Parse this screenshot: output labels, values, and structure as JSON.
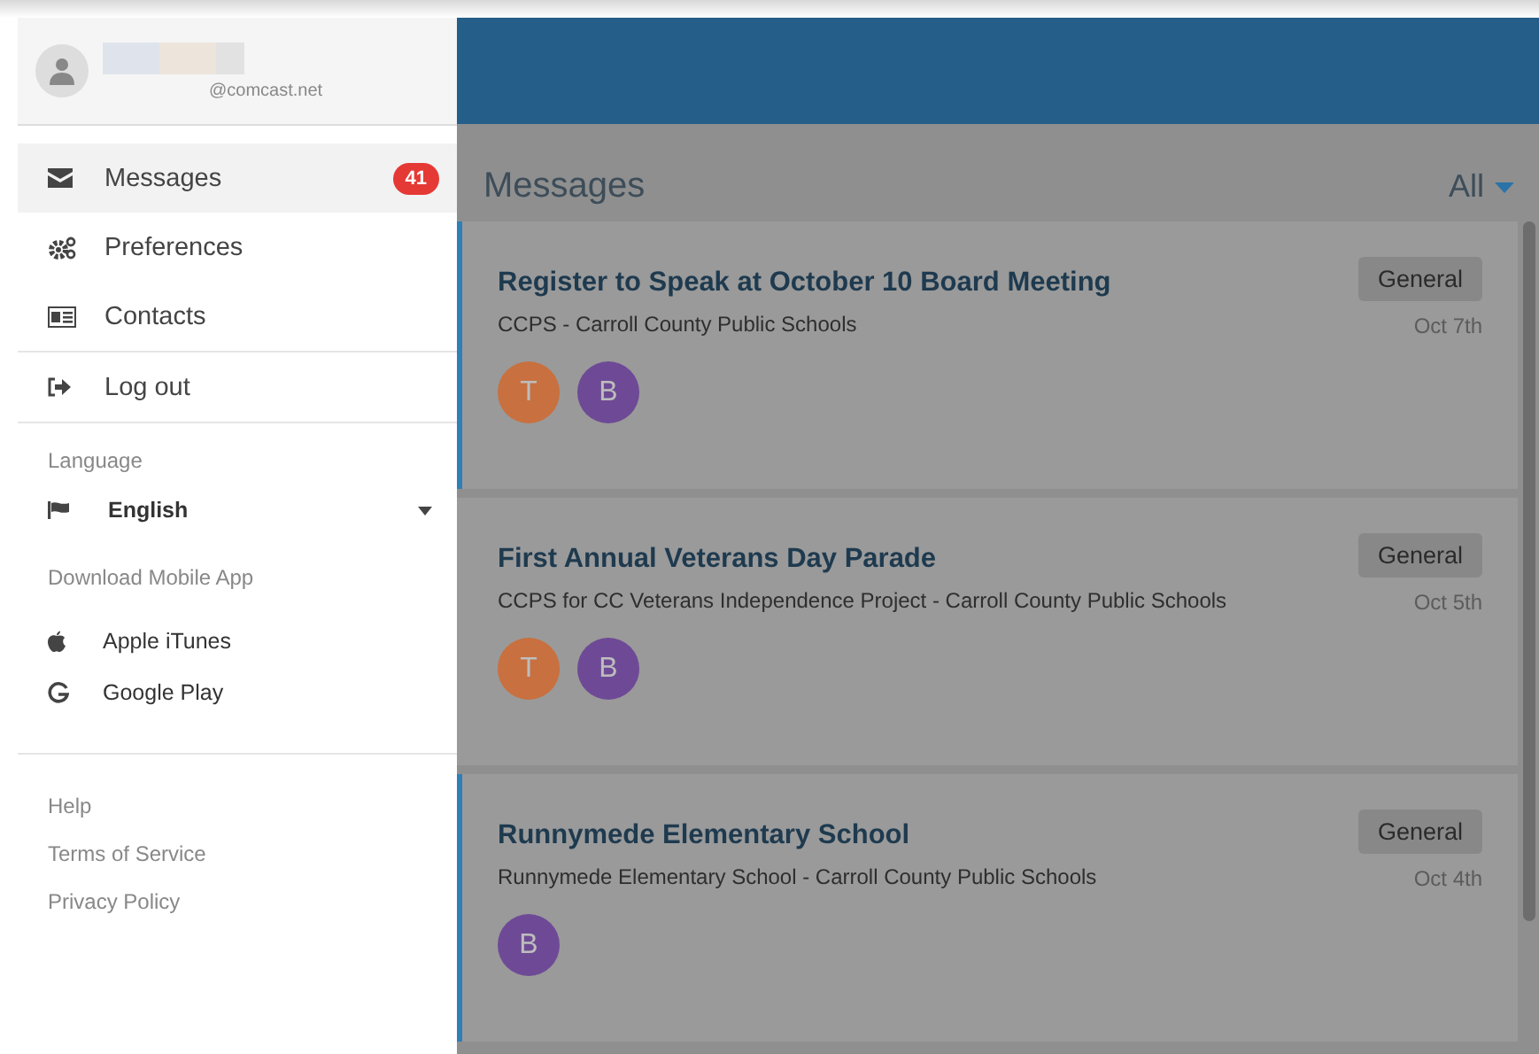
{
  "account": {
    "email": "@comcast.net"
  },
  "nav": [
    {
      "kind": "mail",
      "label": "Messages",
      "badge": "41",
      "selected": true
    },
    {
      "kind": "gears",
      "label": "Preferences",
      "selected": false
    },
    {
      "kind": "card",
      "label": "Contacts",
      "selected": false
    },
    {
      "kind": "logout",
      "label": "Log out",
      "selected": false
    }
  ],
  "language": {
    "heading": "Language",
    "value": "English"
  },
  "download": {
    "heading": "Download Mobile App",
    "links": [
      {
        "kind": "apple",
        "label": "Apple iTunes"
      },
      {
        "kind": "google",
        "label": "Google Play"
      }
    ]
  },
  "footer_links": [
    "Help",
    "Terms of Service",
    "Privacy Policy"
  ],
  "main": {
    "title": "Messages",
    "filter": "All"
  },
  "messages": [
    {
      "title": "Register to Speak at October 10 Board Meeting",
      "sender": "CCPS - Carroll County Public Schools",
      "tag": "General",
      "date": "Oct 7th",
      "unread": true,
      "avatars": [
        {
          "letter": "T",
          "color": "#c8703f"
        },
        {
          "letter": "B",
          "color": "#6e4a96"
        }
      ]
    },
    {
      "title": "First Annual Veterans Day Parade",
      "sender": "CCPS for CC Veterans Independence Project - Carroll County Public Schools",
      "tag": "General",
      "date": "Oct 5th",
      "unread": false,
      "avatars": [
        {
          "letter": "T",
          "color": "#c8703f"
        },
        {
          "letter": "B",
          "color": "#6e4a96"
        }
      ]
    },
    {
      "title": "Runnymede Elementary School",
      "sender": "Runnymede Elementary School - Carroll County Public Schools",
      "tag": "General",
      "date": "Oct 4th",
      "unread": true,
      "avatars": [
        {
          "letter": "B",
          "color": "#6e4a96"
        }
      ]
    }
  ]
}
